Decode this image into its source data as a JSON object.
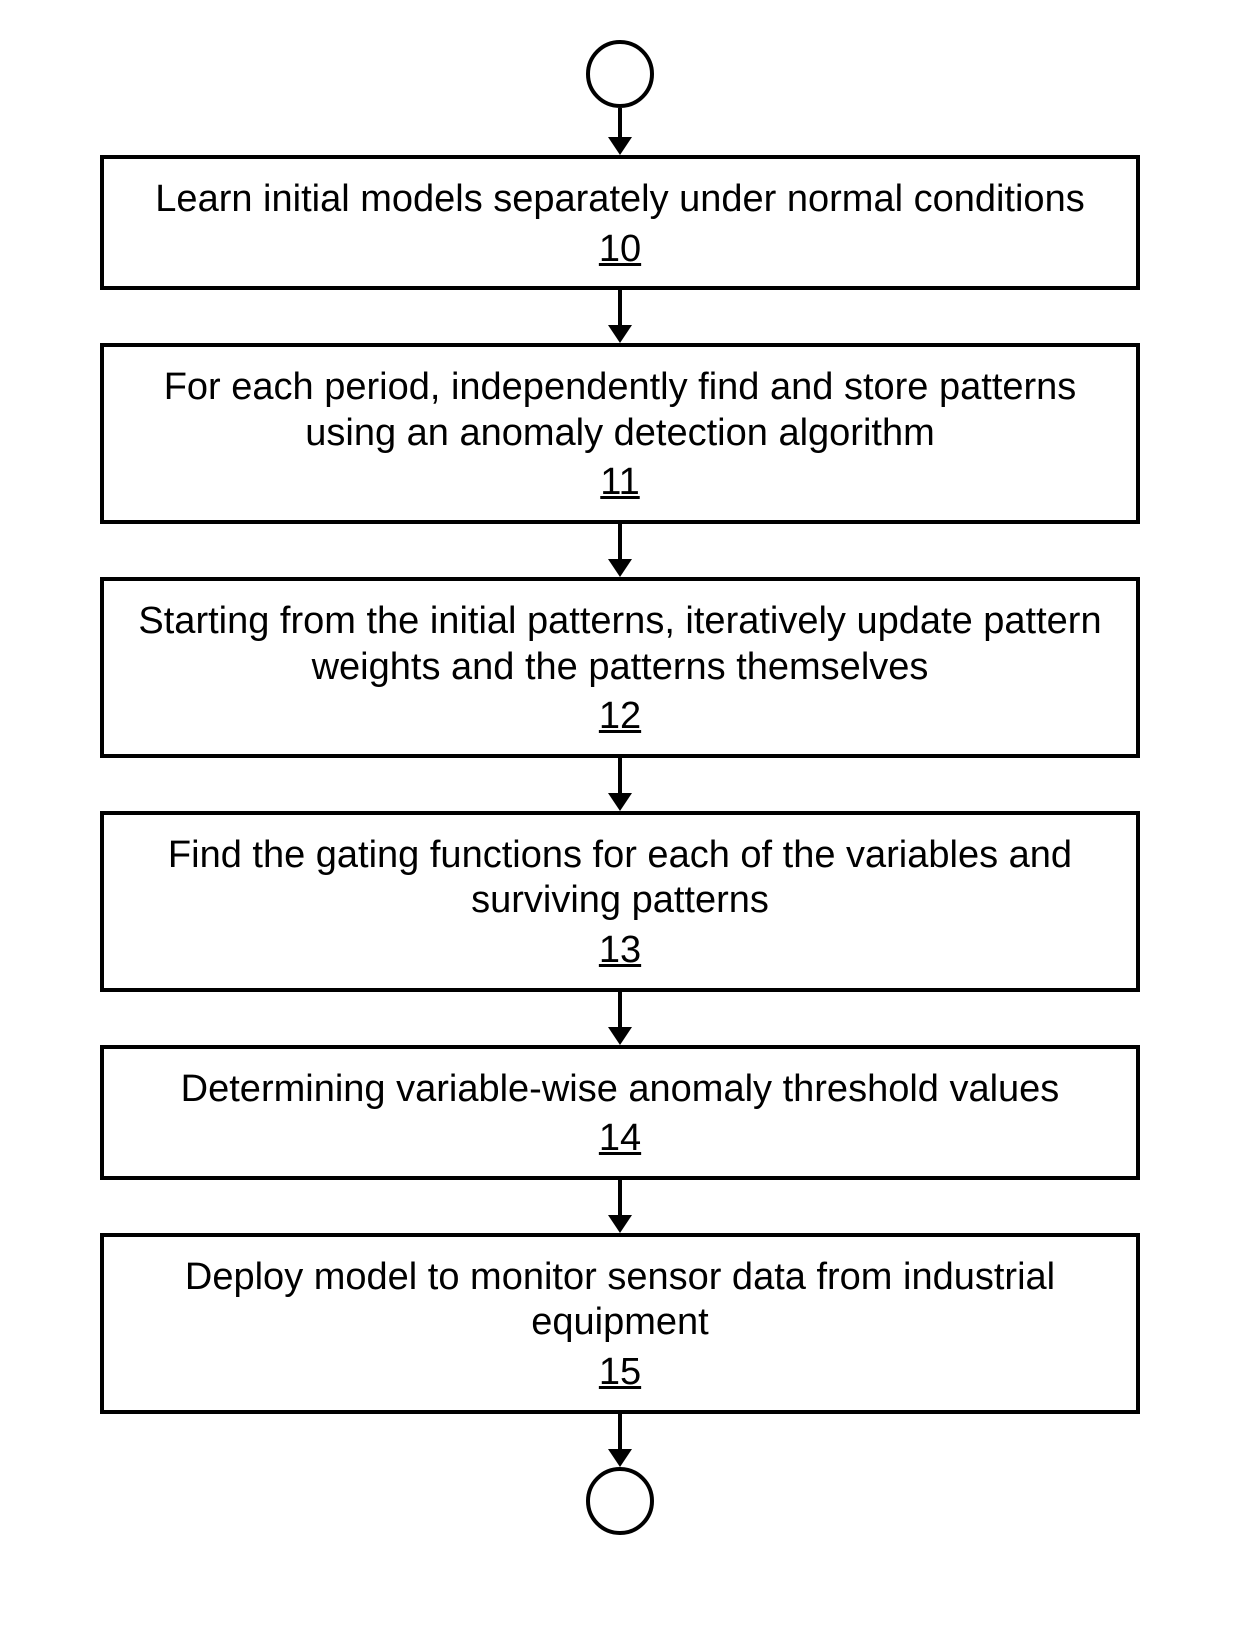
{
  "flowchart": {
    "steps": [
      {
        "label": "Learn initial models separately under normal conditions",
        "number": "10"
      },
      {
        "label": "For each period, independently find and store patterns using an anomaly detection algorithm",
        "number": "11"
      },
      {
        "label": "Starting from the initial patterns, iteratively update pattern weights and the patterns themselves",
        "number": "12"
      },
      {
        "label": "Find the gating functions for each of the variables and surviving patterns",
        "number": "13"
      },
      {
        "label": "Determining variable-wise anomaly threshold values",
        "number": "14"
      },
      {
        "label": "Deploy model to monitor sensor data from industrial equipment",
        "number": "15"
      }
    ]
  }
}
